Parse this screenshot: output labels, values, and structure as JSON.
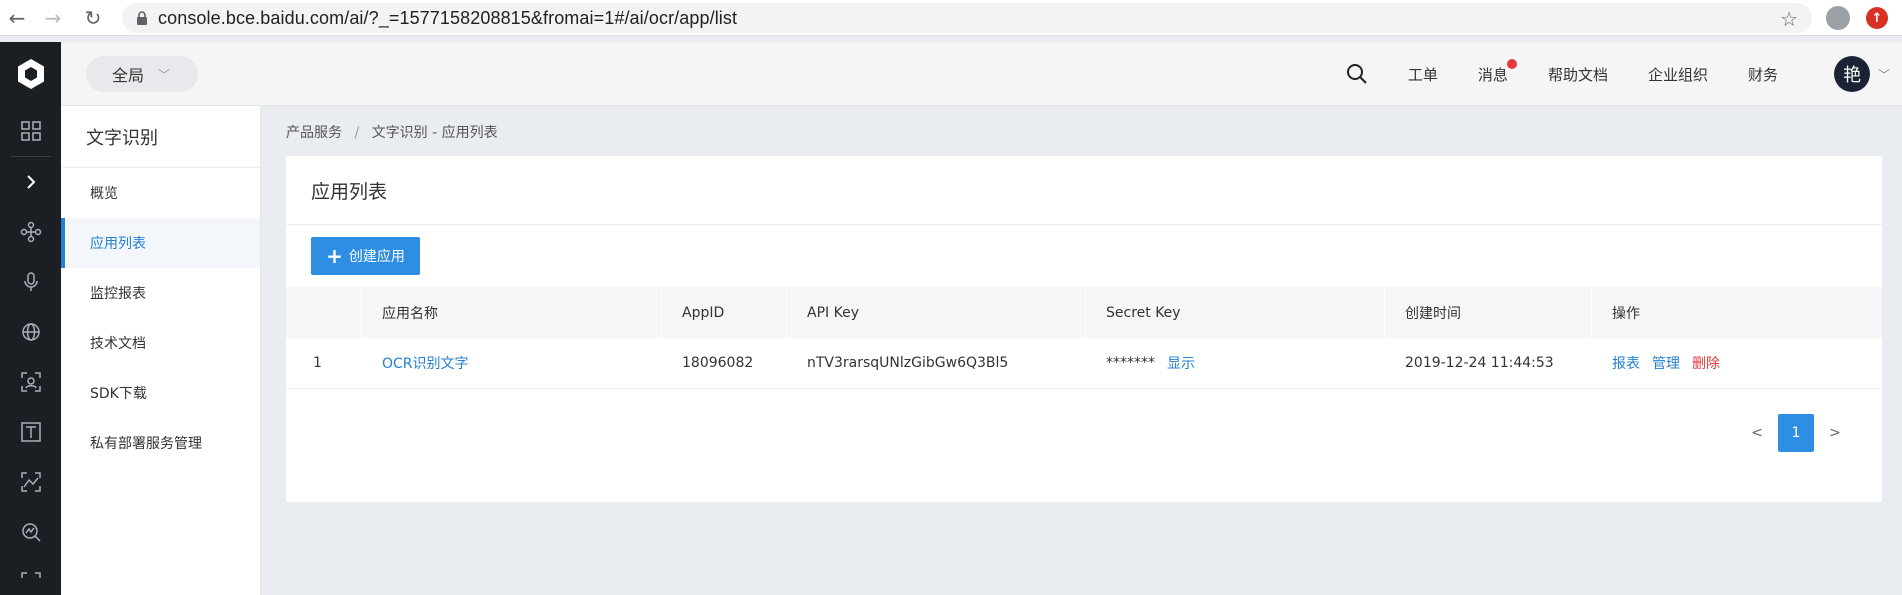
{
  "browser": {
    "url": "console.bce.baidu.com/ai/?_=1577158208815&fromai=1#/ai/ocr/app/list",
    "back_glyph": "←",
    "forward_glyph": "→",
    "reload_glyph": "↻",
    "star_glyph": "☆",
    "update_glyph": "↑"
  },
  "header": {
    "region": "全局",
    "chevron_glyph": "﹀",
    "links": {
      "ticket": "工单",
      "message": "消息",
      "help": "帮助文档",
      "org": "企业组织",
      "finance": "财务"
    },
    "avatar_text": "艳",
    "accent_color": "#2481cf",
    "alert_color": "#e4393c"
  },
  "sidebar": {
    "title": "文字识别",
    "items": [
      {
        "label": "概览"
      },
      {
        "label": "应用列表"
      },
      {
        "label": "监控报表"
      },
      {
        "label": "技术文档"
      },
      {
        "label": "SDK下载"
      },
      {
        "label": "私有部署服务管理"
      }
    ]
  },
  "breadcrumb": {
    "root": "产品服务",
    "separator": "/",
    "current": "文字识别 - 应用列表"
  },
  "main": {
    "title": "应用列表",
    "create_button": "创建应用",
    "plus_glyph": "+",
    "table": {
      "headers": [
        "应用名称",
        "AppID",
        "API Key",
        "Secret Key",
        "创建时间",
        "操作"
      ],
      "rows": [
        {
          "index": "1",
          "name": "OCR识别文字",
          "app_id": "18096082",
          "api_key": "nTV3rarsqUNlzGibGw6Q3Bl5",
          "secret_mask": "*******",
          "secret_show": "显示",
          "created": "2019-12-24 11:44:53",
          "op_report": "报表",
          "op_manage": "管理",
          "op_delete": "删除"
        }
      ]
    },
    "pager": {
      "prev": "<",
      "current": "1",
      "next": ">"
    }
  }
}
